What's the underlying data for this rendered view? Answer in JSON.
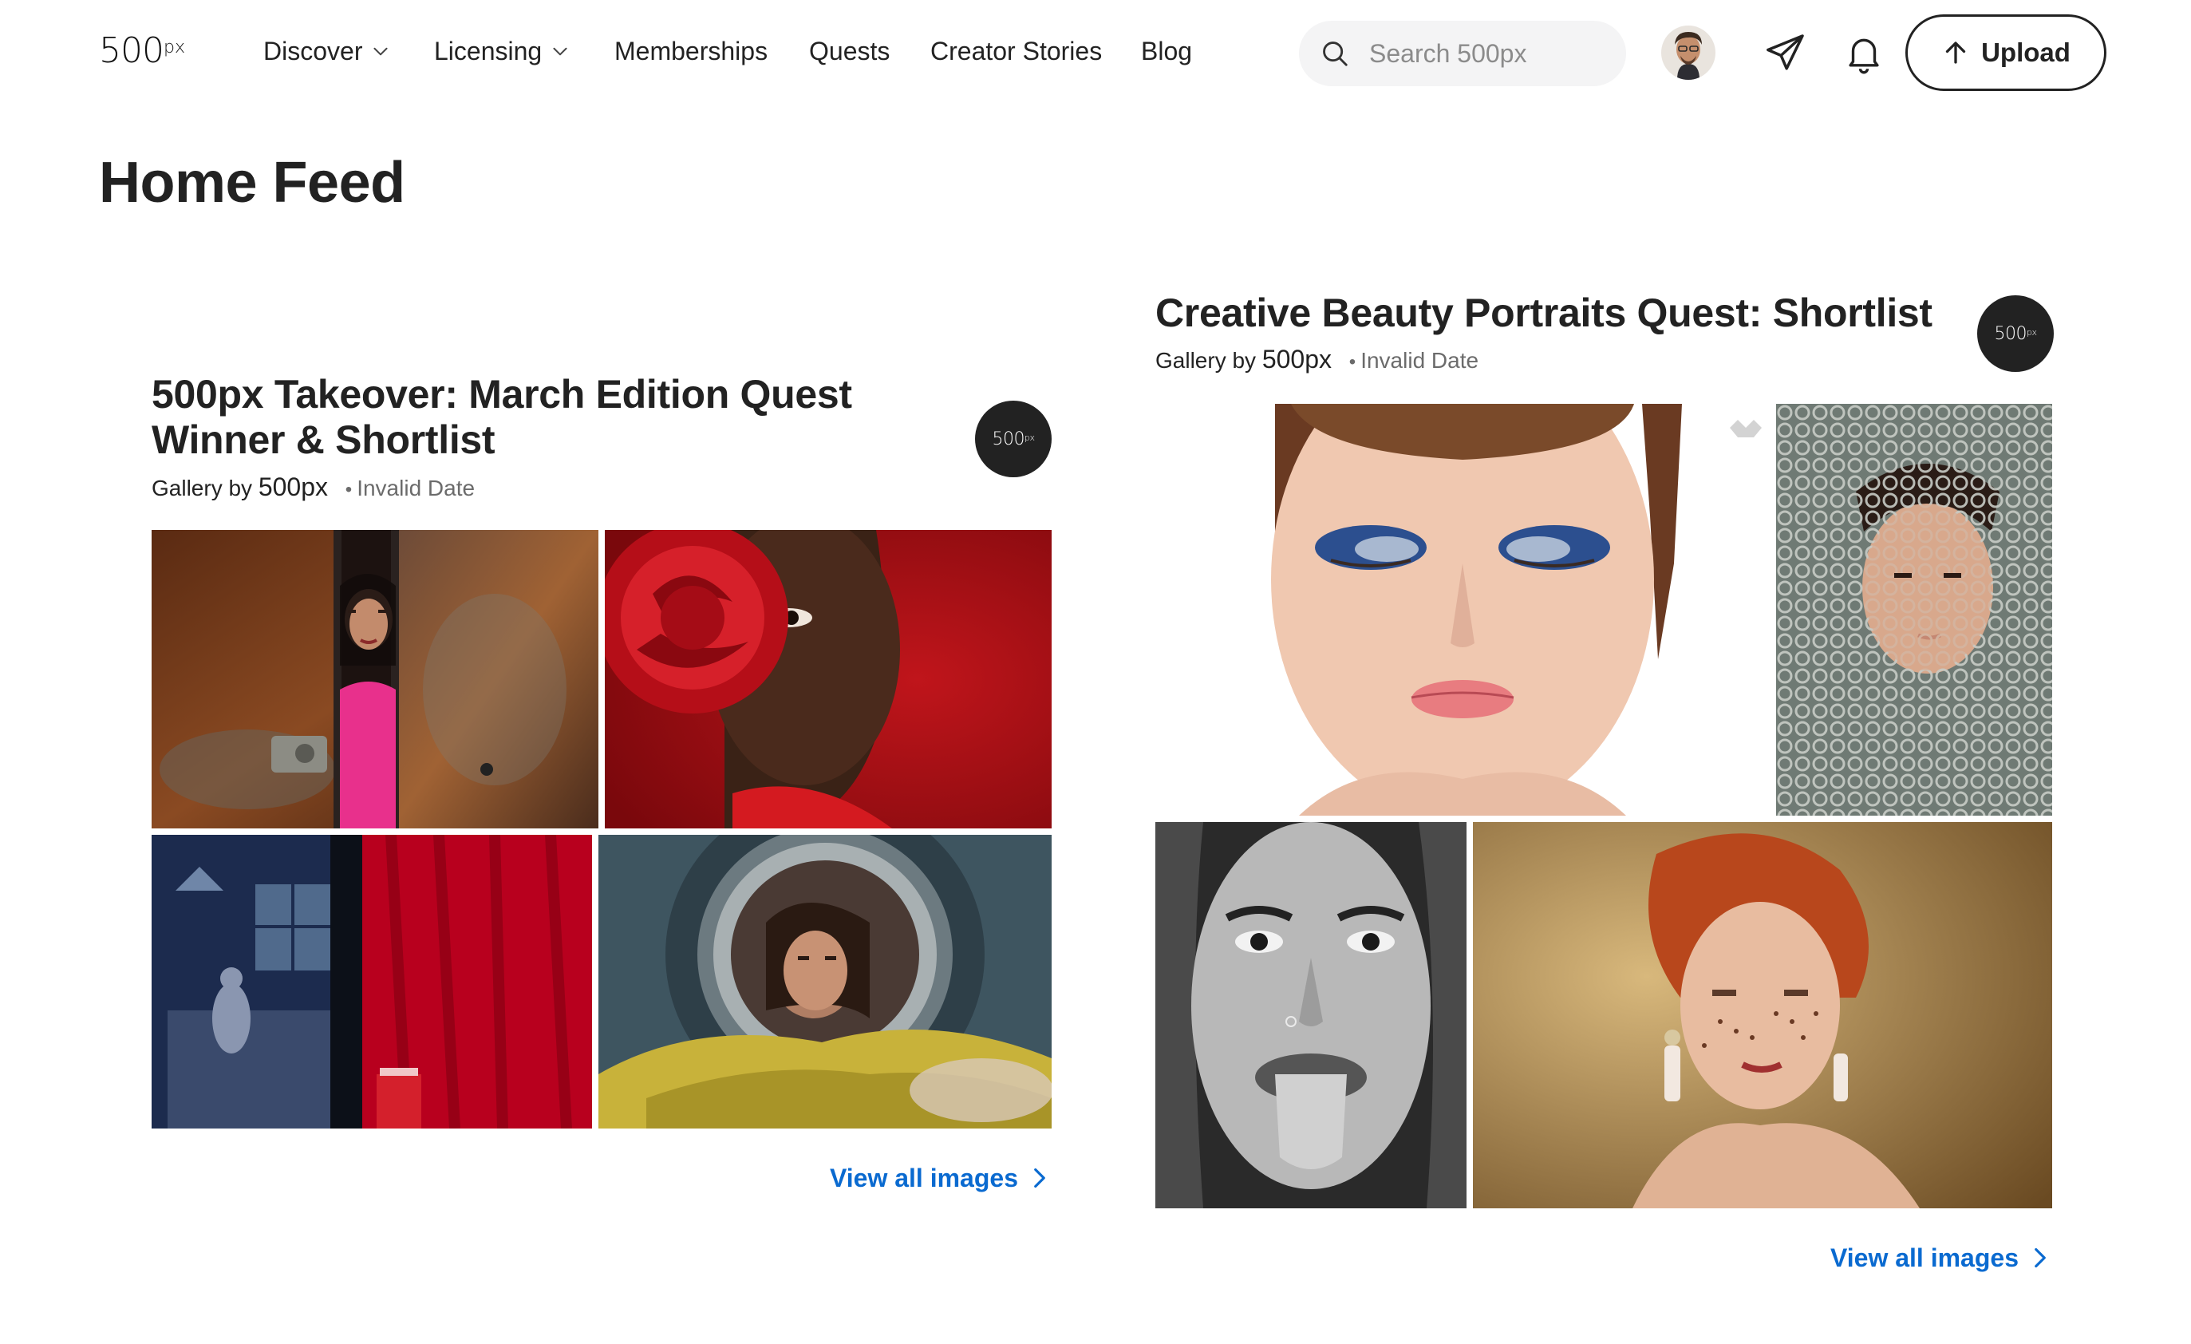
{
  "header": {
    "logo": "500",
    "logo_sup": "px",
    "nav": [
      {
        "label": "Discover",
        "has_dropdown": true
      },
      {
        "label": "Licensing",
        "has_dropdown": true
      },
      {
        "label": "Memberships",
        "has_dropdown": false
      },
      {
        "label": "Quests",
        "has_dropdown": false
      },
      {
        "label": "Creator Stories",
        "has_dropdown": false
      },
      {
        "label": "Blog",
        "has_dropdown": false
      }
    ],
    "search": {
      "placeholder": "Search 500px",
      "value": "",
      "icon": "search-icon"
    },
    "icons": [
      "avatar",
      "paper-plane-icon",
      "bell-icon"
    ],
    "upload_label": "Upload"
  },
  "page": {
    "title": "Home Feed"
  },
  "galleries": [
    {
      "title": "500px Takeover: March Edition Quest Winner & Shortlist",
      "by_prefix": "Gallery by",
      "by_name": "500px",
      "date": "Invalid Date",
      "badge": "500",
      "badge_sup": "px",
      "view_all": "View all images"
    },
    {
      "title": "Creative Beauty Portraits Quest: Shortlist",
      "by_prefix": "Gallery by",
      "by_name": "500px",
      "date": "Invalid Date",
      "badge": "500",
      "badge_sup": "px",
      "view_all": "View all images"
    }
  ],
  "colors": {
    "text": "#222222",
    "muted": "#6b6b6b",
    "link": "#0a6ad0",
    "search_bg": "#f4f4f5"
  }
}
